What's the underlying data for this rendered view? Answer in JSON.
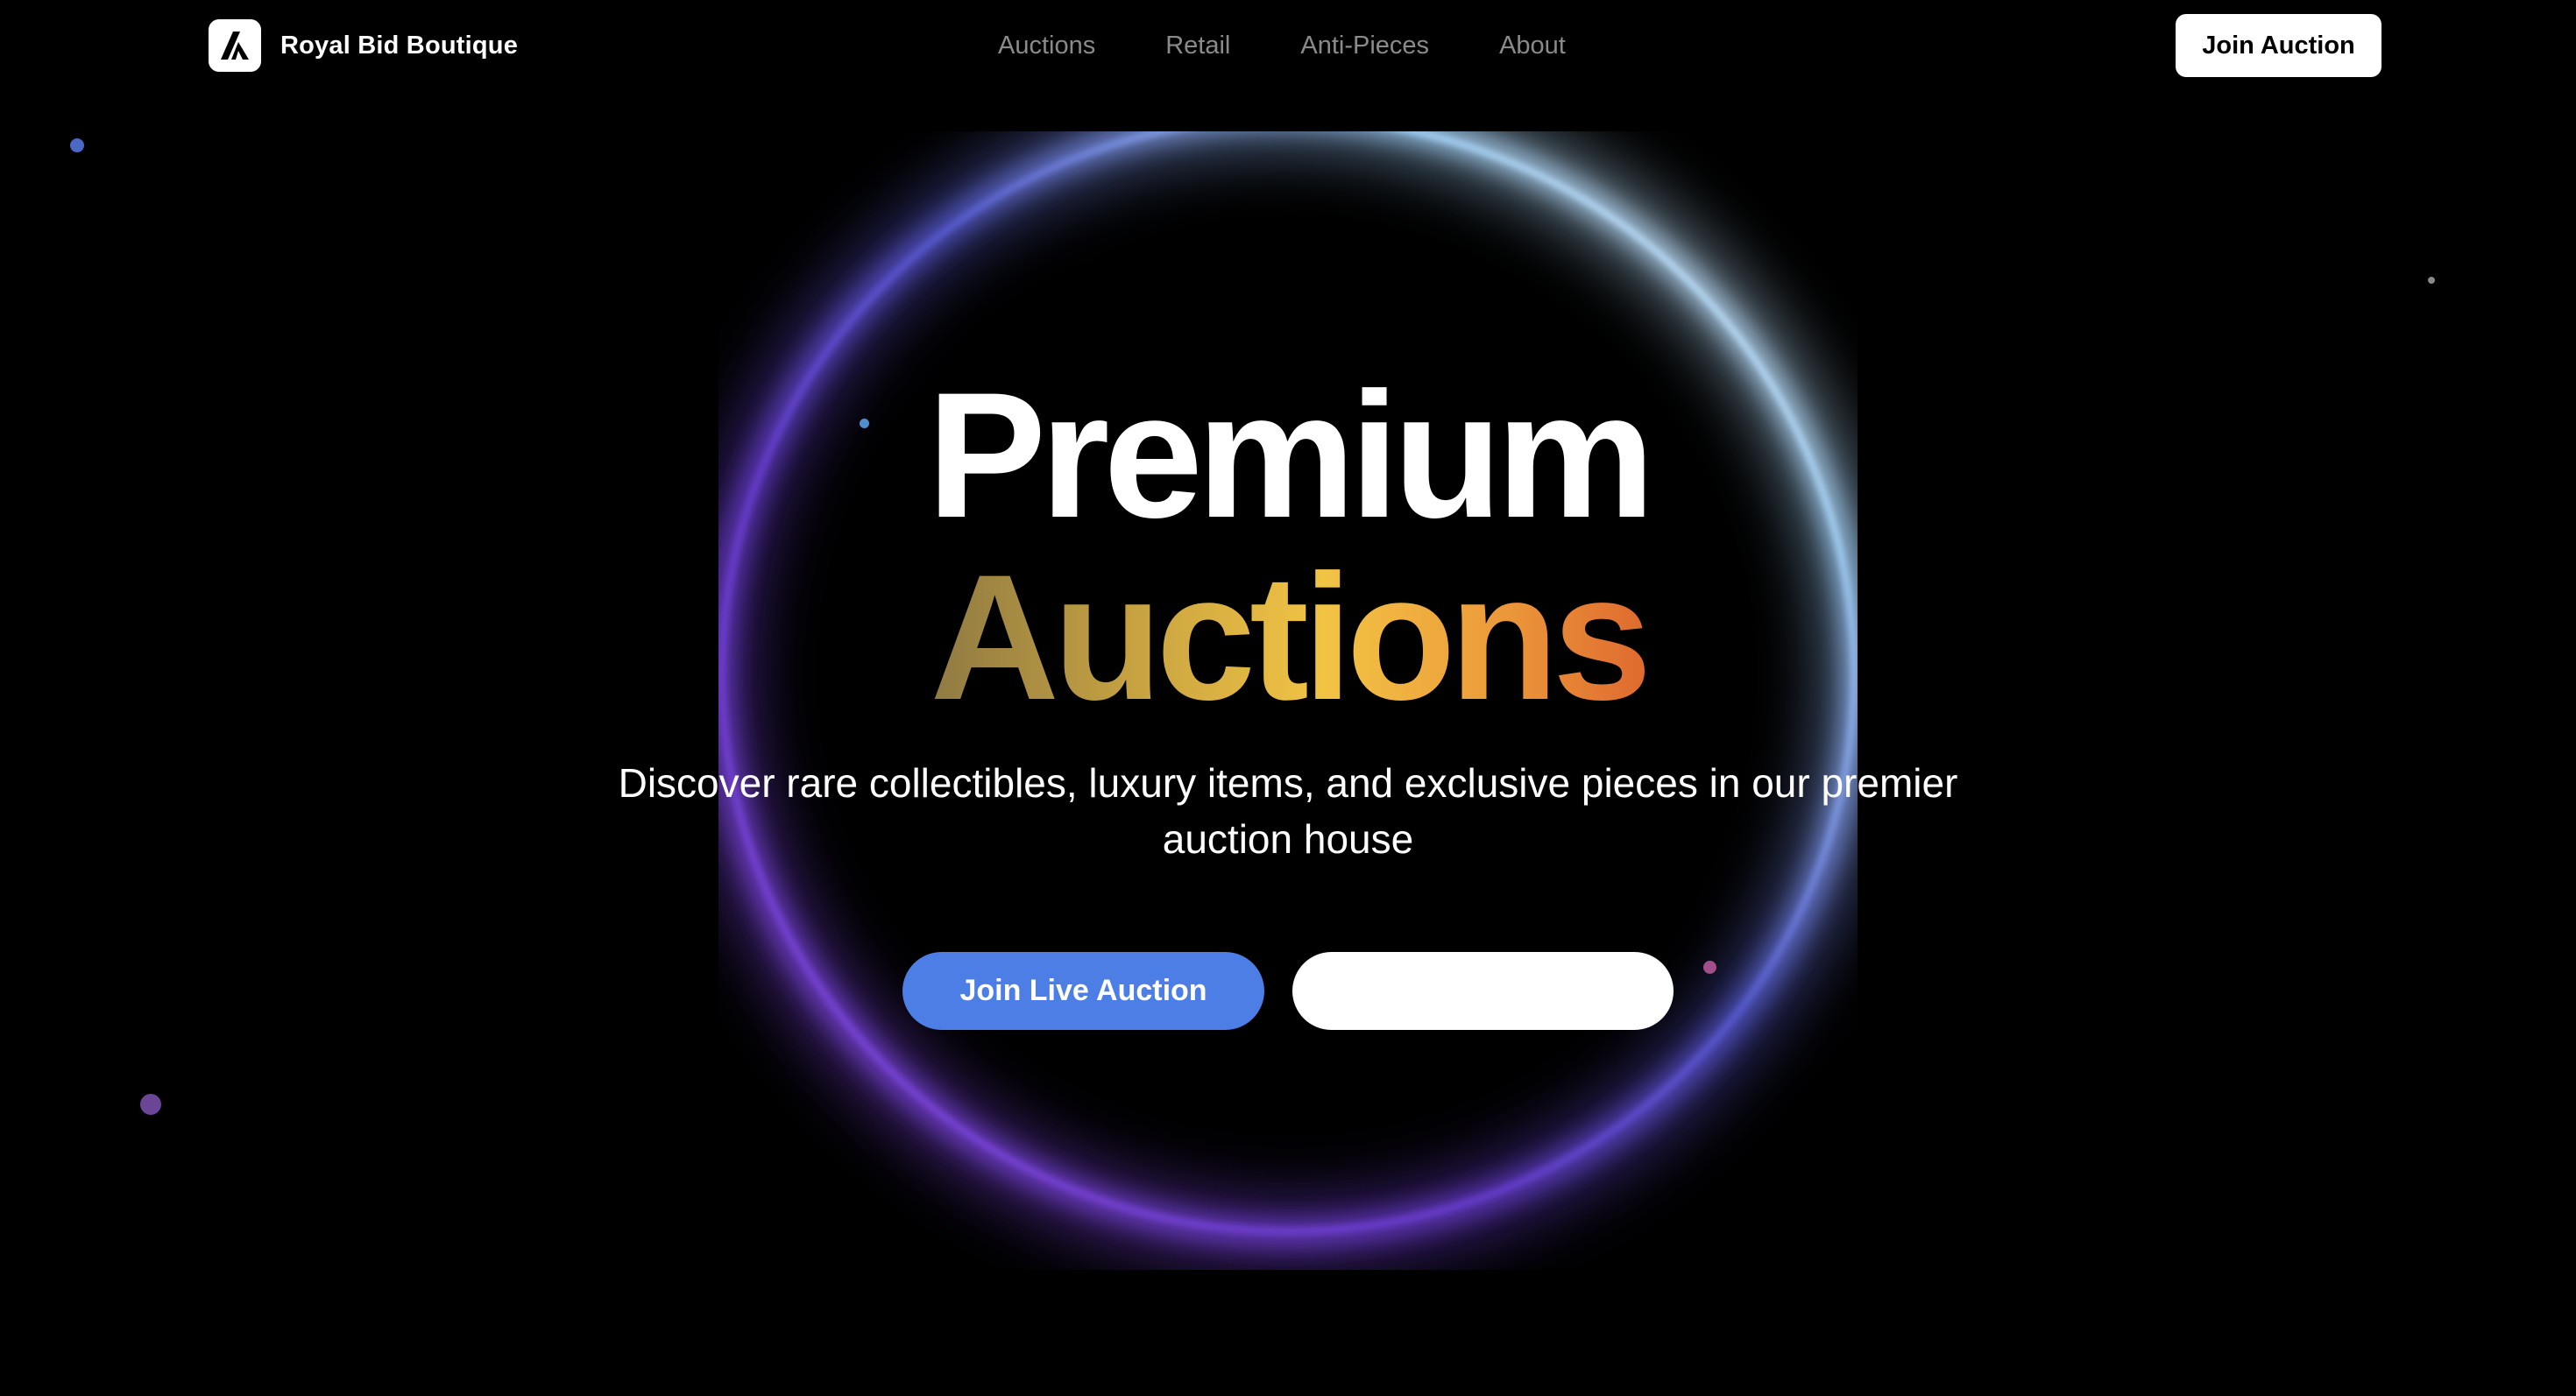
{
  "brand": {
    "name": "Royal Bid Boutique",
    "logo_icon": "stylized-a-logo-icon"
  },
  "nav": {
    "items": [
      {
        "label": "Auctions"
      },
      {
        "label": "Retail"
      },
      {
        "label": "Anti-Pieces"
      },
      {
        "label": "About"
      }
    ]
  },
  "header": {
    "cta_label": "Join Auction"
  },
  "hero": {
    "title_line_1": "Premium",
    "title_line_2": "Auctions",
    "subtitle": "Discover rare collectibles, luxury items, and exclusive pieces in our premier auction house",
    "primary_button_label": "Join Live Auction",
    "secondary_button_label": ""
  },
  "colors": {
    "background": "#000000",
    "primary_button": "#4c7ee6",
    "ring_purple": "#7b3fe0",
    "ring_cyan": "#bfe8ff",
    "title_gradient": [
      "#8f7a43",
      "#f2c444",
      "#df6a2f"
    ]
  }
}
